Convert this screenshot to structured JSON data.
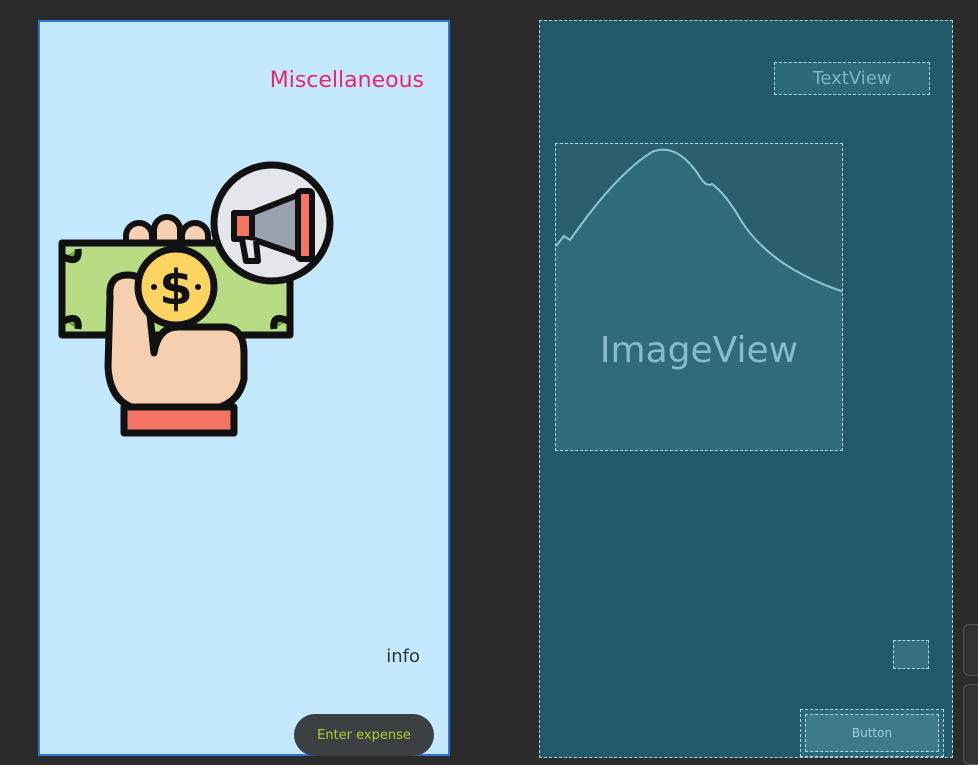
{
  "design": {
    "title": "Miscellaneous",
    "info_label": "info",
    "enter_button_label": "Enter expense",
    "hero_image": "money-hand-megaphone-icon"
  },
  "blueprint": {
    "textview_label": "TextView",
    "imageview_label": "ImageView",
    "button_label": "Button"
  },
  "colors": {
    "title": "#e8266e",
    "design_background": "#c4e8fe",
    "selection_border": "#2f78d8",
    "button_background": "#3d4043",
    "button_text": "#a8d12e",
    "blueprint_background": "#235a6b"
  }
}
